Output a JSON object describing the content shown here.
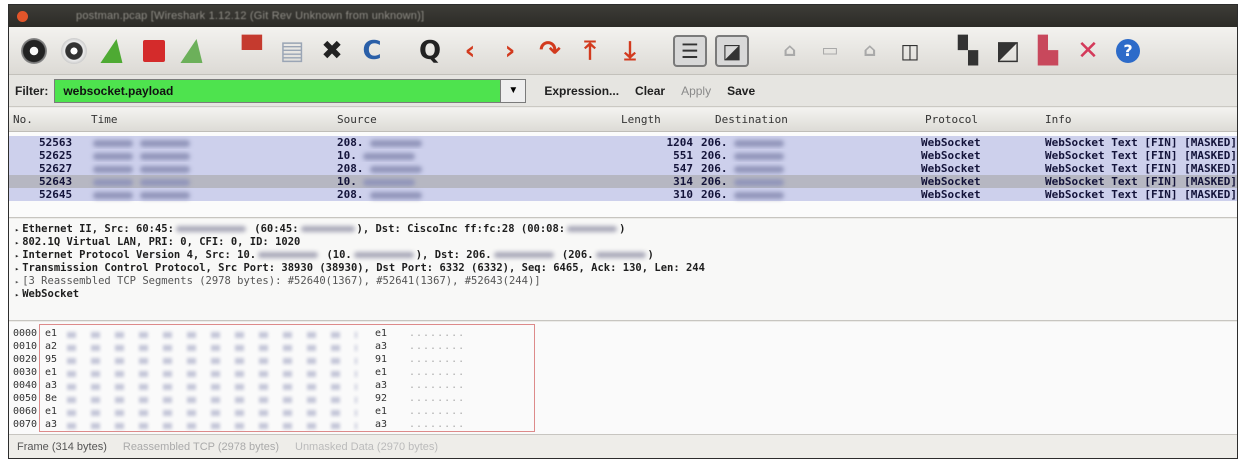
{
  "window": {
    "title": "postman.pcap   [Wireshark 1.12.12 (Git Rev Unknown from unknown)]"
  },
  "toolbar": {
    "icons": [
      "interfaces-icon",
      "capture-options-icon",
      "start-capture-icon",
      "stop-capture-icon",
      "restart-capture-icon",
      "open-file-icon",
      "save-file-icon",
      "close-file-icon",
      "reload-icon",
      "find-icon",
      "go-back-icon",
      "go-forward-icon",
      "go-to-packet-icon",
      "go-first-icon",
      "go-last-icon",
      "colorize-icon",
      "autoscroll-icon",
      "zoom-in-icon",
      "zoom-out-icon",
      "normal-size-icon",
      "resize-columns-icon",
      "capture-filters-icon",
      "display-filters-icon",
      "coloring-rules-icon",
      "preferences-icon",
      "help-icon"
    ]
  },
  "filter": {
    "label": "Filter:",
    "value": "websocket.payload",
    "expression": "Expression...",
    "clear": "Clear",
    "apply": "Apply",
    "save": "Save"
  },
  "packet_list": {
    "columns": {
      "no": "No.",
      "time": "Time",
      "source": "Source",
      "length": "Length",
      "destination": "Destination",
      "protocol": "Protocol",
      "info": "Info"
    },
    "rows": [
      {
        "no": "52563",
        "source": "208.",
        "length": "1204",
        "destination": "206.",
        "protocol": "WebSocket",
        "info": "WebSocket Text [FIN] [MASKED]"
      },
      {
        "no": "52625",
        "source": "10.",
        "length": "551",
        "destination": "206.",
        "protocol": "WebSocket",
        "info": "WebSocket Text [FIN] [MASKED]"
      },
      {
        "no": "52627",
        "source": "208.",
        "length": "547",
        "destination": "206.",
        "protocol": "WebSocket",
        "info": "WebSocket Text [FIN] [MASKED]"
      },
      {
        "no": "52643",
        "source": "10.",
        "length": "314",
        "destination": "206.",
        "protocol": "WebSocket",
        "info": "WebSocket Text [FIN] [MASKED]"
      },
      {
        "no": "52645",
        "source": "208.",
        "length": "310",
        "destination": "206.",
        "protocol": "WebSocket",
        "info": "WebSocket Text [FIN] [MASKED]"
      }
    ],
    "selected_index": 3
  },
  "details": {
    "eth_a": "Ethernet II, Src: 60:45:",
    "eth_b": " (60:45:",
    "eth_c": "), Dst: CiscoInc ff:fc:28 (00:08:",
    "eth_d": ")",
    "vlan": "802.1Q Virtual LAN, PRI: 0, CFI: 0, ID: 1020",
    "ip_a": "Internet Protocol Version 4, Src: 10.",
    "ip_b": " (10.",
    "ip_c": "), Dst: 206.",
    "ip_d": " (206.",
    "ip_e": ")",
    "tcp": "Transmission Control Protocol, Src Port: 38930 (38930), Dst Port: 6332 (6332), Seq: 6465, Ack: 130, Len: 244",
    "reassembled": "[3 Reassembled TCP Segments (2978 bytes): #52640(1367), #52641(1367), #52643(244)]",
    "websocket": "WebSocket"
  },
  "hex": {
    "offsets": [
      "0000",
      "0010",
      "0020",
      "0030",
      "0040",
      "0050",
      "0060",
      "0070"
    ],
    "first": [
      "e1",
      "a2",
      "95",
      "e1",
      "a3",
      "8e",
      "e1",
      "a3"
    ],
    "last": [
      "e1",
      "a3",
      "91",
      "e1",
      "a3",
      "92",
      "e1",
      "a3"
    ],
    "ascii": [
      "........",
      "........",
      "........",
      "........",
      "........",
      "........",
      "........",
      "........"
    ]
  },
  "status_tabs": {
    "frame": "Frame (314 bytes)",
    "reassembled": "Reassembled TCP (2978 bytes)",
    "unmasked": "Unmasked Data (2970 bytes)"
  }
}
